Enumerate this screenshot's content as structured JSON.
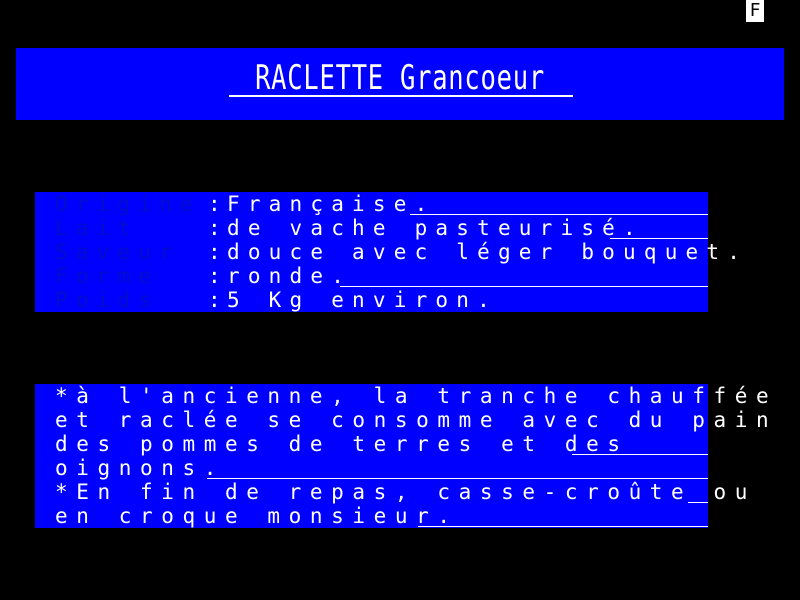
{
  "corner_badge": "F",
  "title": "RACLETTE Grancoeur",
  "specs": [
    {
      "label": "Origine",
      "colon": ":",
      "value": "Française."
    },
    {
      "label": "Lait",
      "colon": ":",
      "value": "de vache pasteurisé."
    },
    {
      "label": "Saveur",
      "colon": ":",
      "value": "douce avec léger bouquet."
    },
    {
      "label": "Forme",
      "colon": ":",
      "value": "ronde."
    },
    {
      "label": "Poids",
      "colon": ":",
      "value": "5 Kg environ."
    }
  ],
  "notes": [
    "*à l'ancienne, la tranche chauffée",
    "et raclée se consomme avec du pain",
    "des pommes de terres et des",
    "oignons.",
    "*En fin de repas, casse-croûte ou",
    "en croque monsieur."
  ],
  "colors": {
    "background": "#000000",
    "panel": "#0000ff",
    "text": "#ffffff",
    "label": "#000ecc"
  }
}
